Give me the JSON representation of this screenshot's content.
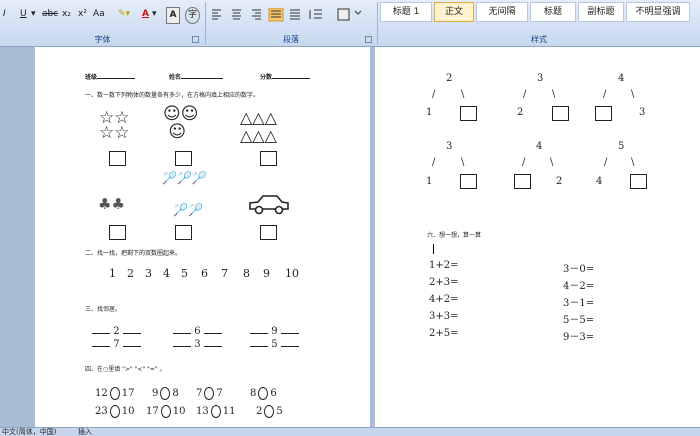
{
  "ribbon": {
    "font_tools": [
      "I",
      "U",
      "abc",
      "x₂",
      "x²",
      "Aa",
      "A"
    ],
    "groups": {
      "font": "字体",
      "paragraph": "段落",
      "styles": "样式"
    },
    "styles": [
      "标题 1",
      "正文",
      "无间隔",
      "标题",
      "副标题",
      "不明显强调"
    ]
  },
  "left_page": {
    "header": {
      "class_label": "班级",
      "name_label": "姓名",
      "score_label": "分数"
    },
    "q1": "一、数一数下列物体的数量各有多少，在方格内填上相应的数字。",
    "q2": "二、找一找，把剩下的双数圈起来。",
    "q2_numbers": [
      "1",
      "2",
      "3",
      "4",
      "5",
      "6",
      "7",
      "8",
      "9",
      "10"
    ],
    "q3": "三、找邻居。",
    "q3_row1": [
      "2",
      "6",
      "9"
    ],
    "q3_row2": [
      "7",
      "3",
      "5"
    ],
    "q4": "四、在○里填 \">\" \"<\" \"=\" 。",
    "q4_rows": [
      [
        [
          "12",
          "17"
        ],
        [
          "9",
          "8"
        ],
        [
          "7",
          "7"
        ],
        [
          "8",
          "6"
        ]
      ],
      [
        [
          "23",
          "10"
        ],
        [
          "17",
          "10"
        ],
        [
          "13",
          "11"
        ],
        [
          "2",
          "5"
        ]
      ]
    ]
  },
  "right_page": {
    "trees": [
      {
        "top": "2",
        "left": "1"
      },
      {
        "top": "3",
        "left": "2"
      },
      {
        "top": "4",
        "right": "3"
      },
      {
        "top": "3",
        "left": "1"
      },
      {
        "top": "4",
        "right": "2"
      },
      {
        "top": "5",
        "left": "4"
      }
    ],
    "q6": "六、想一想，算一算",
    "left_eqs": [
      "1+2=",
      "2+3=",
      "4+2=",
      "3+3=",
      "2+5="
    ],
    "right_eqs": [
      "3－0=",
      "4－2=",
      "3－1=",
      "5－5=",
      "9－3="
    ]
  },
  "status_bar": {
    "language": "中文(简体，中国)",
    "mode": "插入"
  }
}
